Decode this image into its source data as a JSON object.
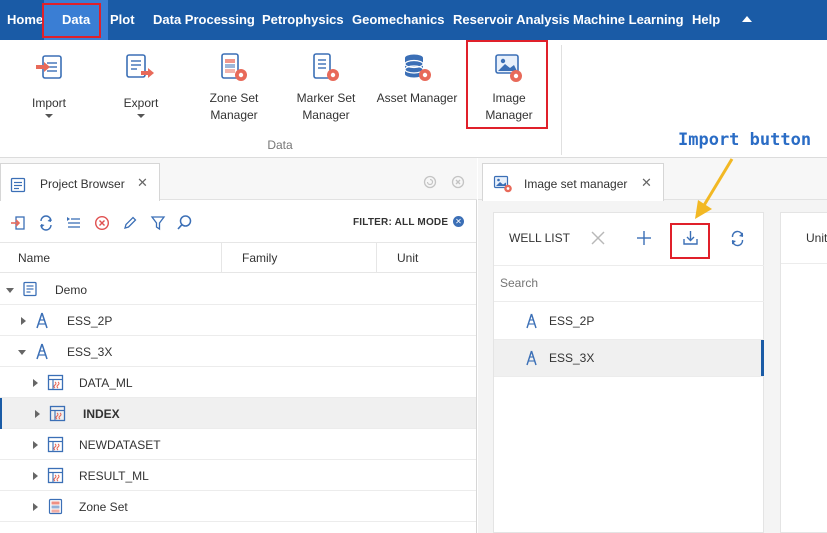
{
  "menubar": {
    "items": [
      "Home",
      "Data",
      "Plot",
      "Data Processing",
      "Petrophysics",
      "Geomechanics",
      "Reservoir Analysis",
      "Machine Learning",
      "Help"
    ],
    "active": "Data",
    "accent": "#1a5ba6"
  },
  "ribbon": {
    "buttons": [
      {
        "label": "Import",
        "icon": "import-icon"
      },
      {
        "label": "Export",
        "icon": "export-icon"
      },
      {
        "label1": "Zone Set",
        "label2": "Manager",
        "icon": "zone-set-icon"
      },
      {
        "label1": "Marker Set",
        "label2": "Manager",
        "icon": "marker-set-icon"
      },
      {
        "label": "Asset Manager",
        "icon": "asset-manager-icon"
      },
      {
        "label1": "Image",
        "label2": "Manager",
        "icon": "image-manager-icon"
      }
    ],
    "group_label": "Data"
  },
  "project_browser": {
    "tab_label": "Project Browser",
    "filter_label": "FILTER: ALL MODE",
    "columns": [
      "Name",
      "Family",
      "Unit"
    ],
    "tree": [
      {
        "label": "Demo",
        "level": 0,
        "expanded": true,
        "icon": "project-icon"
      },
      {
        "label": "ESS_2P",
        "level": 1,
        "expanded": false,
        "icon": "well-icon"
      },
      {
        "label": "ESS_3X",
        "level": 1,
        "expanded": true,
        "icon": "well-icon"
      },
      {
        "label": "DATA_ML",
        "level": 2,
        "expanded": false,
        "icon": "dataset-icon"
      },
      {
        "label": "INDEX",
        "level": 2,
        "expanded": false,
        "icon": "dataset-icon",
        "selected": true
      },
      {
        "label": "NEWDATASET",
        "level": 2,
        "expanded": false,
        "icon": "dataset-icon"
      },
      {
        "label": "RESULT_ML",
        "level": 2,
        "expanded": false,
        "icon": "dataset-icon"
      },
      {
        "label": "Zone Set",
        "level": 2,
        "expanded": false,
        "icon": "zone-set-icon"
      }
    ]
  },
  "image_set_manager": {
    "tab_label": "Image set manager",
    "well_list_label": "WELL LIST",
    "search_placeholder": "Search",
    "wells": [
      {
        "label": "ESS_2P",
        "selected": false
      },
      {
        "label": "ESS_3X",
        "selected": true
      }
    ],
    "right_panel_header": "Unit"
  },
  "annotation": {
    "text": "Import button",
    "color": "#2a6cc5",
    "arrow_color": "#f2b824",
    "highlight_color": "#e0202a"
  }
}
